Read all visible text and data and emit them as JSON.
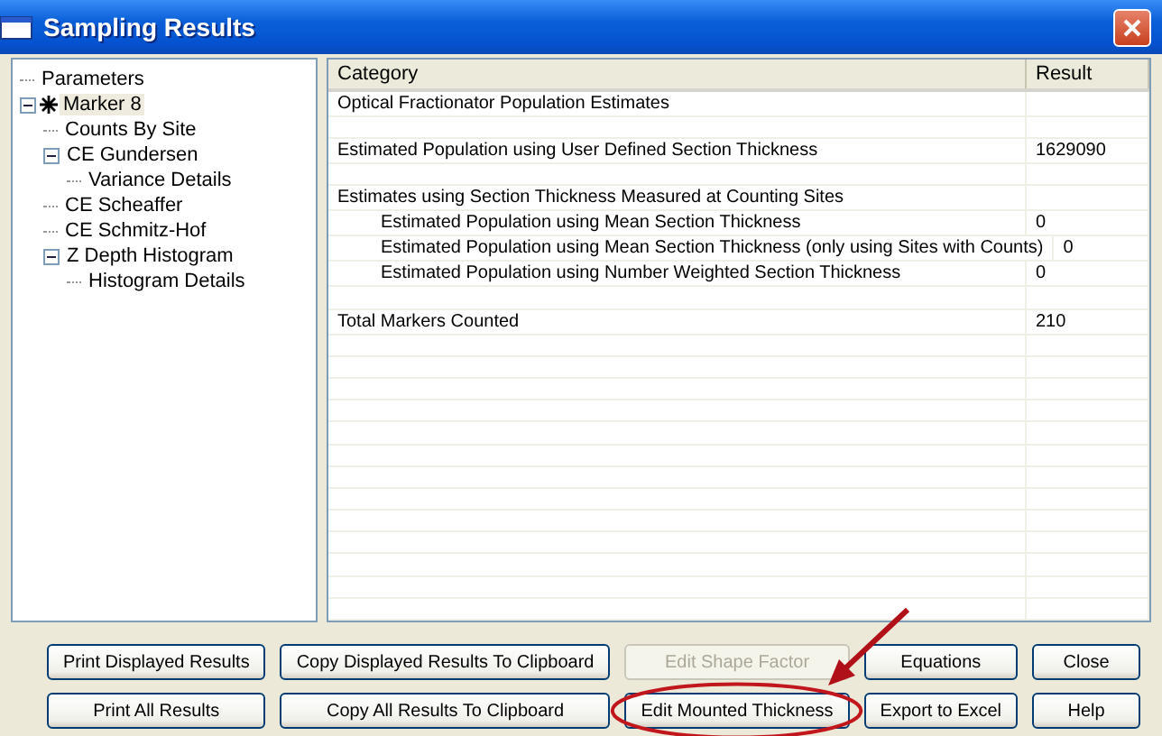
{
  "window": {
    "title": "Sampling Results"
  },
  "tree": [
    {
      "label": "Parameters",
      "selected": false
    },
    {
      "label": "Marker 8",
      "selected": true,
      "expanded": true,
      "children": [
        {
          "label": "Counts By Site",
          "selected": false
        },
        {
          "label": "CE Gundersen",
          "selected": false,
          "expanded": true,
          "children": [
            {
              "label": "Variance Details",
              "selected": false
            }
          ]
        },
        {
          "label": "CE Scheaffer",
          "selected": false
        },
        {
          "label": "CE Schmitz-Hof",
          "selected": false
        },
        {
          "label": "Z Depth Histogram",
          "selected": false,
          "expanded": true,
          "children": [
            {
              "label": "Histogram Details",
              "selected": false
            }
          ]
        }
      ]
    }
  ],
  "table": {
    "columns": [
      "Category",
      "Result"
    ],
    "rows": [
      {
        "kind": "text",
        "category": "Optical Fractionator Population Estimates"
      },
      {
        "kind": "blank"
      },
      {
        "kind": "text",
        "category": "Estimated Population using User Defined Section Thickness",
        "result": "1629090"
      },
      {
        "kind": "blank"
      },
      {
        "kind": "text",
        "category": "Estimates using Section Thickness Measured at Counting Sites",
        "children": [
          {
            "kind": "text",
            "category": "Estimated Population using Mean Section Thickness",
            "result": "0"
          },
          {
            "kind": "text",
            "category": "Estimated Population using Mean Section Thickness (only using Sites with Counts)",
            "result": "0"
          },
          {
            "kind": "text",
            "category": "Estimated Population using Number Weighted Section Thickness",
            "result": "0"
          }
        ]
      },
      {
        "kind": "blank"
      },
      {
        "kind": "text",
        "category": "Total Markers Counted",
        "result": "210"
      }
    ]
  },
  "buttons": [
    {
      "label": "Print Displayed Results",
      "disabled": false,
      "circled": false
    },
    {
      "label": "Copy Displayed Results To Clipboard",
      "disabled": false,
      "circled": false
    },
    {
      "label": "Edit Shape Factor",
      "disabled": true,
      "circled": false
    },
    {
      "label": "Equations",
      "disabled": false,
      "circled": false
    },
    {
      "label": "Close",
      "disabled": false,
      "circled": false
    },
    {
      "label": "Print All Results",
      "disabled": false,
      "circled": false
    },
    {
      "label": "Copy All Results To Clipboard",
      "disabled": false,
      "circled": false
    },
    {
      "label": "Edit Mounted Thickness",
      "disabled": false,
      "circled": true
    },
    {
      "label": "Export to Excel",
      "disabled": false,
      "circled": false
    },
    {
      "label": "Help",
      "disabled": false,
      "circled": false
    }
  ]
}
